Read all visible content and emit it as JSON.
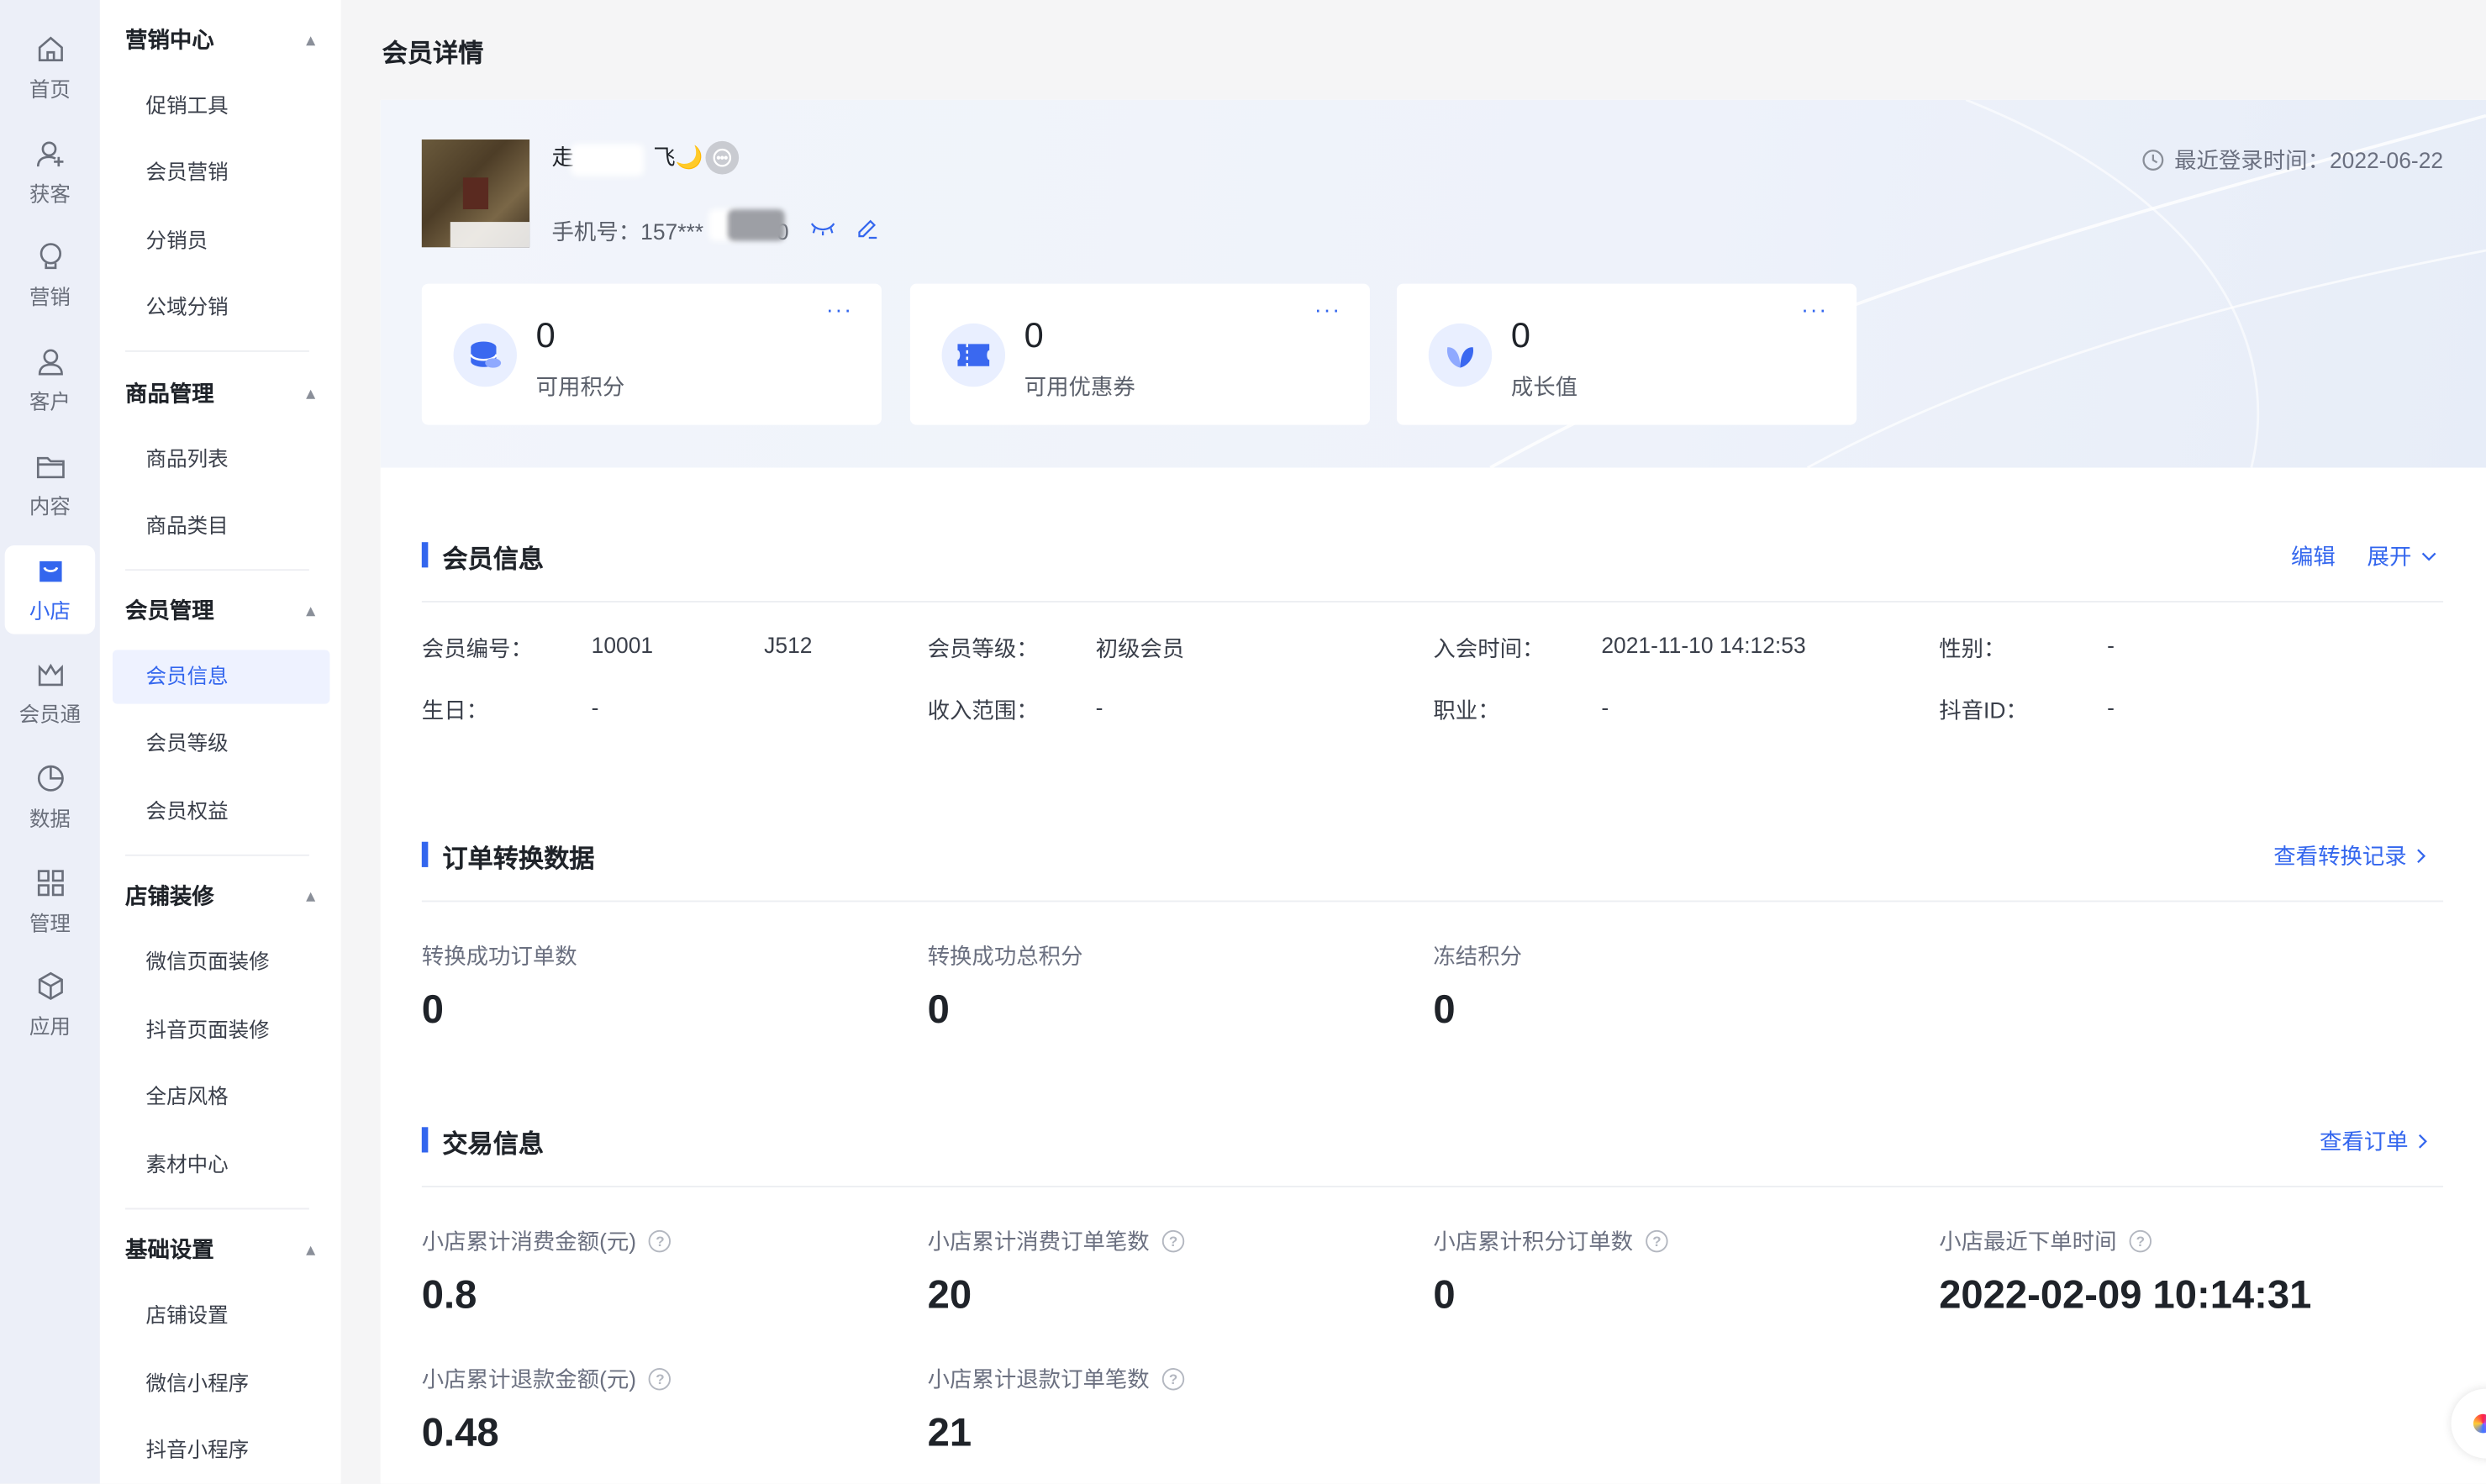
{
  "rail": [
    {
      "label": "首页",
      "icon": "home-icon"
    },
    {
      "label": "获客",
      "icon": "user-add-icon"
    },
    {
      "label": "营销",
      "icon": "bulb-icon"
    },
    {
      "label": "客户",
      "icon": "user-icon"
    },
    {
      "label": "内容",
      "icon": "folder-icon"
    },
    {
      "label": "小店",
      "icon": "shop-icon",
      "active": true
    },
    {
      "label": "会员通",
      "icon": "crown-icon"
    },
    {
      "label": "数据",
      "icon": "pie-chart-icon"
    },
    {
      "label": "管理",
      "icon": "grid-icon"
    },
    {
      "label": "应用",
      "icon": "cube-icon"
    }
  ],
  "menu": {
    "groups": [
      {
        "title": "营销中心",
        "items": [
          "促销工具",
          "会员营销",
          "分销员",
          "公域分销"
        ]
      },
      {
        "title": "商品管理",
        "items": [
          "商品列表",
          "商品类目"
        ]
      },
      {
        "title": "会员管理",
        "items": [
          "会员信息",
          "会员等级",
          "会员权益"
        ]
      },
      {
        "title": "店铺装修",
        "items": [
          "微信页面装修",
          "抖音页面装修",
          "全店风格",
          "素材中心"
        ]
      },
      {
        "title": "基础设置",
        "items": [
          "店铺设置",
          "微信小程序",
          "抖音小程序"
        ]
      }
    ],
    "active_item": "会员信息"
  },
  "page_title": "会员详情",
  "member": {
    "name_start": "走",
    "name_end": "飞🌙",
    "phone_label": "手机号：",
    "phone_value": "157***",
    "phone_tail": "0",
    "last_login": "最近登录时间：2022-06-22"
  },
  "stats": [
    {
      "value": "0",
      "label": "可用积分",
      "icon": "coins-icon",
      "more": "···"
    },
    {
      "value": "0",
      "label": "可用优惠券",
      "icon": "ticket-icon",
      "more": "···"
    },
    {
      "value": "0",
      "label": "成长值",
      "icon": "leaf-icon",
      "more": "···"
    }
  ],
  "member_info": {
    "title": "会员信息",
    "edit": "编辑",
    "expand": "展开",
    "fields": [
      {
        "label": "会员编号：",
        "value": "10001",
        "value_tail": "J512"
      },
      {
        "label": "会员等级：",
        "value": "初级会员"
      },
      {
        "label": "入会时间：",
        "value": "2021-11-10 14:12:53"
      },
      {
        "label": "性别：",
        "value": "-"
      },
      {
        "label": "生日：",
        "value": "-"
      },
      {
        "label": "收入范围：",
        "value": "-"
      },
      {
        "label": "职业：",
        "value": "-"
      },
      {
        "label": "抖音ID：",
        "value": "-"
      }
    ]
  },
  "order_conv": {
    "title": "订单转换数据",
    "link": "查看转换记录",
    "metrics": [
      {
        "label": "转换成功订单数",
        "value": "0"
      },
      {
        "label": "转换成功总积分",
        "value": "0"
      },
      {
        "label": "冻结积分",
        "value": "0"
      }
    ]
  },
  "trade": {
    "title": "交易信息",
    "link": "查看订单",
    "metrics": [
      {
        "label": "小店累计消费金额(元)",
        "value": "0.8"
      },
      {
        "label": "小店累计消费订单笔数",
        "value": "20"
      },
      {
        "label": "小店累计积分订单数",
        "value": "0"
      },
      {
        "label": "小店最近下单时间",
        "value": "2022-02-09 10:14:31"
      },
      {
        "label": "小店累计退款金额(元)",
        "value": "0.48"
      },
      {
        "label": "小店累计退款订单笔数",
        "value": "21"
      }
    ]
  },
  "colors": {
    "accent": "#3366ee",
    "rail_bg": "#eceff8",
    "page_bg": "#f5f5f6"
  }
}
